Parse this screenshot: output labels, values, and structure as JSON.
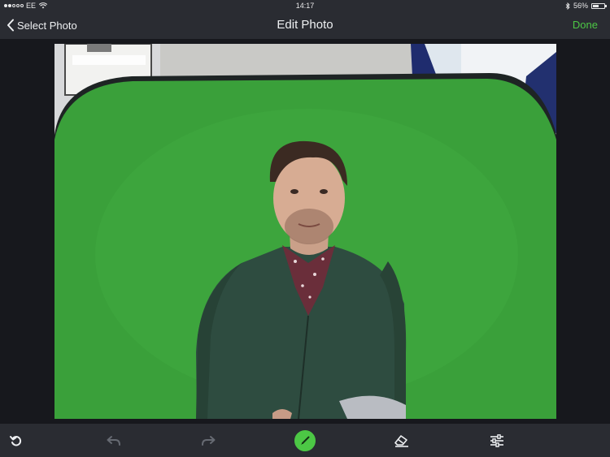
{
  "status_bar": {
    "carrier": "EE",
    "time": "14:17",
    "battery_percent": "56%",
    "battery_level": 0.56
  },
  "nav": {
    "back_label": "Select Photo",
    "title": "Edit Photo",
    "done_label": "Done"
  },
  "colors": {
    "accent_green": "#4cc745",
    "bar_background": "#2a2c32",
    "canvas_background": "#17181d",
    "tool_disabled": "#666a72",
    "tool_enabled": "#eef0f2"
  },
  "toolbar": {
    "tools": [
      {
        "name": "reset",
        "icon": "rotate-ccw-icon",
        "enabled": true
      },
      {
        "name": "undo",
        "icon": "undo-icon",
        "enabled": false
      },
      {
        "name": "redo",
        "icon": "redo-icon",
        "enabled": false
      },
      {
        "name": "brush",
        "icon": "brush-icon",
        "enabled": true,
        "selected": true
      },
      {
        "name": "eraser",
        "icon": "eraser-icon",
        "enabled": true
      },
      {
        "name": "adjustments",
        "icon": "sliders-icon",
        "enabled": true
      }
    ]
  }
}
